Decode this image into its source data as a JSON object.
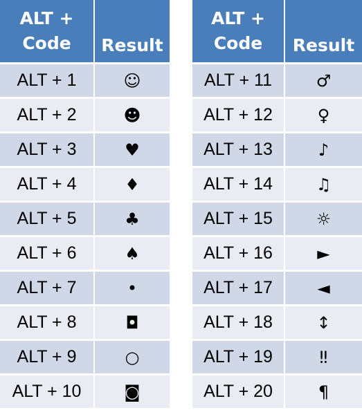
{
  "colors": {
    "header": "#4a7ebb",
    "row_odd": "#d0d8e8",
    "row_even": "#e9ecf2"
  },
  "tables": [
    {
      "header": {
        "code": "ALT +\nCode",
        "result": "Result"
      },
      "rows": [
        {
          "code": "ALT + 1",
          "result": "☺"
        },
        {
          "code": "ALT + 2",
          "result": "☻"
        },
        {
          "code": "ALT + 3",
          "result": "♥"
        },
        {
          "code": "ALT + 4",
          "result": "♦"
        },
        {
          "code": "ALT + 5",
          "result": "♣"
        },
        {
          "code": "ALT + 6",
          "result": "♠"
        },
        {
          "code": "ALT + 7",
          "result": "•"
        },
        {
          "code": "ALT + 8",
          "result": "◘"
        },
        {
          "code": "ALT + 9",
          "result": "○"
        },
        {
          "code": "ALT + 10",
          "result": "◙"
        }
      ]
    },
    {
      "header": {
        "code": "ALT +\nCode",
        "result": "Result"
      },
      "rows": [
        {
          "code": "ALT + 11",
          "result": "♂"
        },
        {
          "code": "ALT + 12",
          "result": "♀"
        },
        {
          "code": "ALT + 13",
          "result": "♪"
        },
        {
          "code": "ALT + 14",
          "result": "♫"
        },
        {
          "code": "ALT + 15",
          "result": "☼"
        },
        {
          "code": "ALT + 16",
          "result": "►"
        },
        {
          "code": "ALT + 17",
          "result": "◄"
        },
        {
          "code": "ALT + 18",
          "result": "↕"
        },
        {
          "code": "ALT + 19",
          "result": "‼"
        },
        {
          "code": "ALT + 20",
          "result": "¶"
        }
      ]
    }
  ]
}
